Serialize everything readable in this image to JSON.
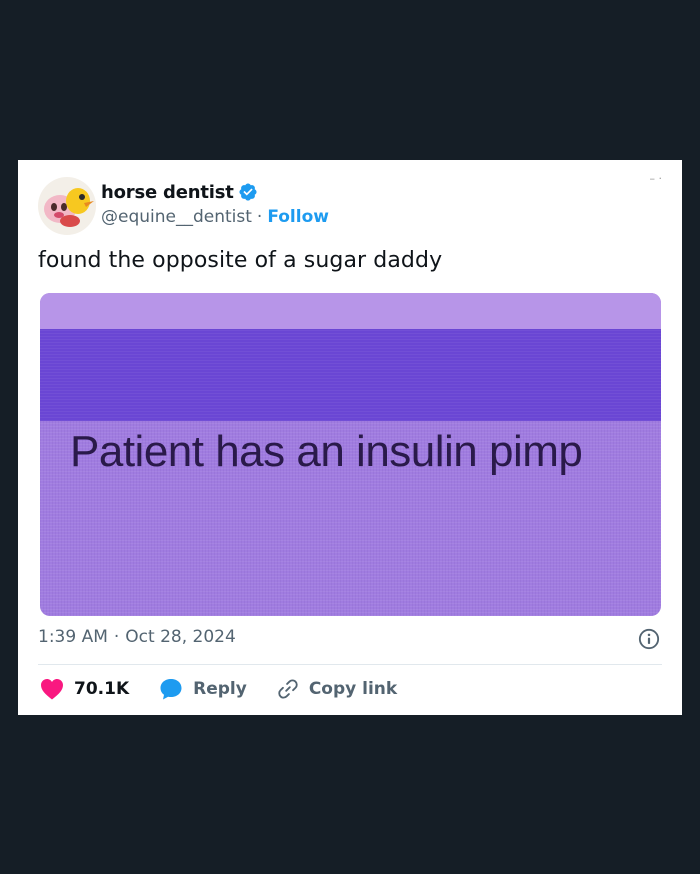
{
  "author": {
    "display_name": "horse dentist",
    "handle": "@equine__dentist",
    "separator": "·",
    "follow_label": "Follow",
    "verified": true,
    "avatar_icon": "cartoon-avatar-icon"
  },
  "tweet": {
    "text": "found the opposite of a sugar daddy",
    "image_caption": "Patient has an insulin pimp"
  },
  "meta": {
    "time": "1:39 AM",
    "separator": "·",
    "date": "Oct 28, 2024"
  },
  "actions": {
    "like_count": "70.1K",
    "reply_label": "Reply",
    "copy_label": "Copy link"
  },
  "colors": {
    "background": "#151e26",
    "card": "#ffffff",
    "accent": "#1d9bf0",
    "like": "#f91880",
    "text": "#0f1419",
    "muted": "#536471"
  }
}
